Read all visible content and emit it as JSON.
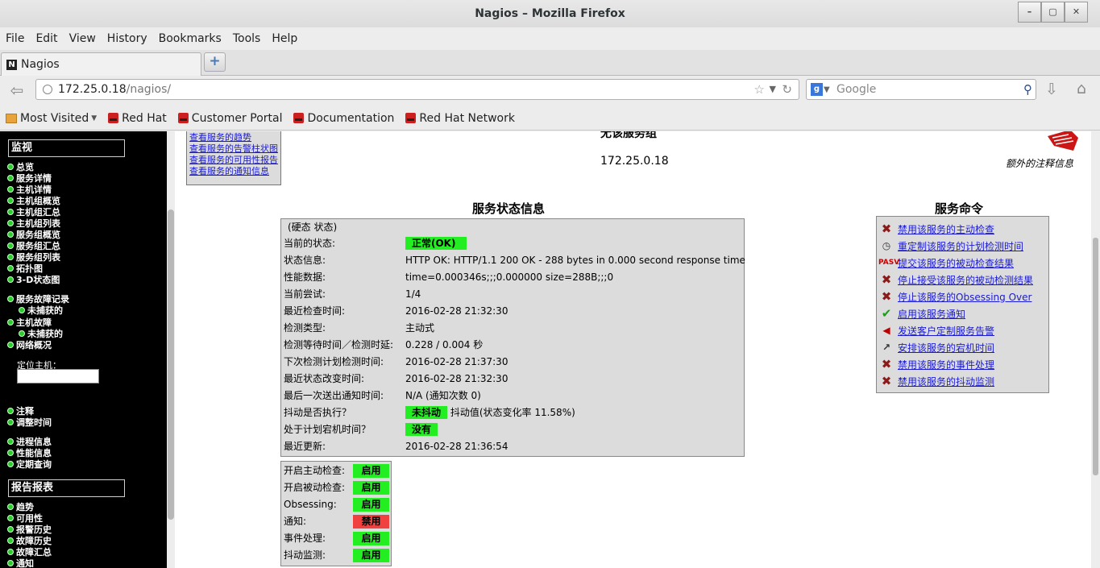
{
  "window": {
    "title": "Nagios – Mozilla Firefox",
    "buttons": [
      "–",
      "▢",
      "✕"
    ]
  },
  "menu": [
    "File",
    "Edit",
    "View",
    "History",
    "Bookmarks",
    "Tools",
    "Help"
  ],
  "tab": {
    "title": "Nagios",
    "icon_letter": "N",
    "new_tab_icon": "+"
  },
  "urlbar": {
    "host": "172.25.0.18",
    "path": "/nagios/"
  },
  "search": {
    "placeholder": "Google"
  },
  "bookmarks": {
    "most_visited": "Most Visited",
    "items": [
      "Red Hat",
      "Customer Portal",
      "Documentation",
      "Red Hat Network"
    ]
  },
  "sidebar": {
    "monitor_section": "监视",
    "monitor_items": [
      "总览",
      "服务详情",
      "主机详情",
      "主机组概览",
      "主机组汇总",
      "主机组列表",
      "服务组概览",
      "服务组汇总",
      "服务组列表",
      "拓扑图",
      "3-D状态图"
    ],
    "problems": {
      "service_problems": "服务故障记录",
      "service_unhandled": "未捕获的",
      "host_problems": "主机故障",
      "host_unhandled": "未捕获的",
      "network": "网络概况"
    },
    "locate_label": "定位主机：",
    "group2": [
      "注释",
      "调整时间"
    ],
    "group3": [
      "进程信息",
      "性能信息",
      "定期查询"
    ],
    "reports_section": "报告报表",
    "report_items": [
      "趋势",
      "可用性",
      "报警历史",
      "故障历史",
      "故障汇总",
      "通知"
    ]
  },
  "service_links": [
    "查看服务的趋势",
    "查看服务的告警柱状图",
    "查看服务的可用性报告",
    "查看服务的通知信息"
  ],
  "header": {
    "title": "无该服务组",
    "host": "172.25.0.18",
    "extra_notes": "额外的注释信息"
  },
  "status_section": {
    "title": "服务状态信息",
    "state_type": "(硬态 状态)",
    "rows": [
      {
        "label": "当前的状态:",
        "value": "正常(OK)"
      },
      {
        "label": "状态信息:",
        "value": "HTTP OK: HTTP/1.1 200 OK - 288 bytes in 0.000 second response time"
      },
      {
        "label": "性能数据:",
        "value": "time=0.000346s;;;0.000000 size=288B;;;0"
      },
      {
        "label": "当前尝试:",
        "value": "1/4"
      },
      {
        "label": "最近检查时间:",
        "value": "2016-02-28 21:32:30"
      },
      {
        "label": "检测类型:",
        "value": "主动式"
      },
      {
        "label": "检测等待时间／检测时延:",
        "value": "0.228 / 0.004 秒"
      },
      {
        "label": "下次检测计划检测时间:",
        "value": "2016-02-28 21:37:30"
      },
      {
        "label": "最近状态改变时间:",
        "value": "2016-02-28 21:32:30"
      },
      {
        "label": "最后一次送出通知时间:",
        "value": "N/A (通知次数 0)"
      },
      {
        "label": "抖动是否执行？",
        "value": "未抖动",
        "extra": "抖动值(状态变化率 11.58%)"
      },
      {
        "label": "处于计划宕机时间？",
        "value": "没有"
      },
      {
        "label": "最近更新:",
        "value": "2016-02-28 21:36:54"
      }
    ]
  },
  "features": [
    {
      "label": "开启主动检查:",
      "status": "启用"
    },
    {
      "label": "开启被动检查:",
      "status": "启用"
    },
    {
      "label": "Obsessing:",
      "status": "启用"
    },
    {
      "label": "通知:",
      "status": "禁用"
    },
    {
      "label": "事件处理:",
      "status": "启用"
    },
    {
      "label": "抖动监测:",
      "status": "启用"
    }
  ],
  "commands": {
    "title": "服务命令",
    "items": [
      {
        "label": "禁用该服务的主动检查",
        "icon": "x-icon"
      },
      {
        "label": "重定制该服务的计划检测时间",
        "icon": "schedule-icon"
      },
      {
        "label": "提交该服务的被动检查结果",
        "icon": "passive-icon"
      },
      {
        "label": "停止接受该服务的被动检测结果",
        "icon": "x-icon"
      },
      {
        "label": "停止该服务的Obsessing Over",
        "icon": "x-icon"
      },
      {
        "label": "启用该服务通知",
        "icon": "check-icon"
      },
      {
        "label": "发送客户定制服务告警",
        "icon": "megaphone-icon"
      },
      {
        "label": "安排该服务的宕机时间",
        "icon": "downtime-icon"
      },
      {
        "label": "禁用该服务的事件处理",
        "icon": "x-icon"
      },
      {
        "label": "禁用该服务的抖动监测",
        "icon": "x-icon"
      }
    ]
  },
  "colors": {
    "ok": "#22ee22",
    "disabled": "#f04040",
    "link": "#1a1ad6"
  }
}
